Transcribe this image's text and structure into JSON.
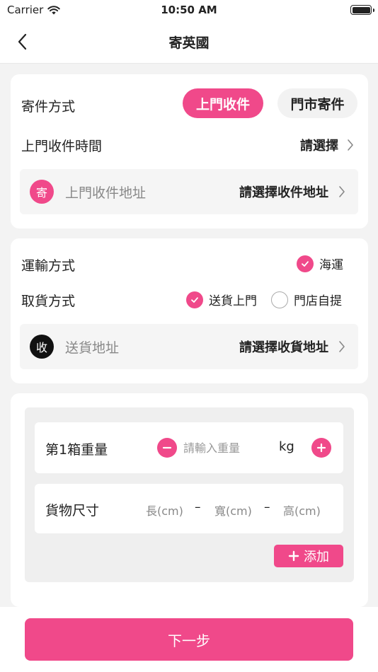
{
  "status_bar": {
    "carrier": "Carrier",
    "time": "10:50 AM"
  },
  "nav": {
    "title": "寄英國"
  },
  "pickup_section": {
    "method_label": "寄件方式",
    "options": [
      "上門收件",
      "門市寄件"
    ],
    "selected_option": "上門收件",
    "time_label": "上門收件時間",
    "time_value": "請選擇",
    "address_icon_text": "寄",
    "address_label": "上門收件地址",
    "address_value": "請選擇收件地址"
  },
  "delivery_section": {
    "transport_label": "運輸方式",
    "transport_option": "海運",
    "transport_selected": true,
    "receive_label": "取貨方式",
    "receive_options": [
      {
        "label": "送貨上門",
        "selected": true
      },
      {
        "label": "門店自提",
        "selected": false
      }
    ],
    "address_icon_text": "收",
    "address_label": "送貨地址",
    "address_value": "請選擇收貨地址"
  },
  "package_section": {
    "weight_label": "第1箱重量",
    "weight_placeholder": "請輸入重量",
    "weight_unit": "kg",
    "size_label": "貨物尺寸",
    "dims": [
      "長(cm)",
      "寬(cm)",
      "高(cm)"
    ],
    "dash": "–",
    "add_label": "添加"
  },
  "footer": {
    "next_label": "下一步"
  },
  "colors": {
    "accent": "#f0498a",
    "pickup_icon": "#f0498a",
    "receive_icon": "#111111"
  },
  "icons": [
    "wifi-icon",
    "battery-icon",
    "back-chevron-icon",
    "chevron-right-icon",
    "checkmark-icon",
    "minus-icon",
    "plus-icon"
  ]
}
